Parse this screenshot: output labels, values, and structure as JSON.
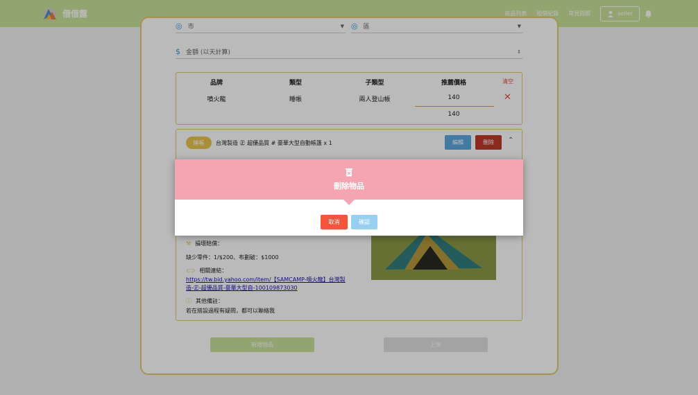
{
  "nav": {
    "brand": "借借露",
    "links": [
      "商品列表",
      "租借紀錄",
      "常見問題"
    ],
    "user": "seller"
  },
  "form": {
    "city_placeholder": "市",
    "district_placeholder": "區",
    "amount_placeholder": "金額 (以天計算)"
  },
  "table": {
    "headers": [
      "品牌",
      "類型",
      "子類型",
      "推薦價格"
    ],
    "clear_label": "清空",
    "row": [
      "噴火龍",
      "睡帳",
      "兩人登山帳",
      "140"
    ],
    "total": "140"
  },
  "item": {
    "tag": "睡帳",
    "title": "台灣製造 ㊣ 超優品質 # 豪華大型自動帳篷 x 1",
    "edit_label": "編輯",
    "delete_label": "刪除",
    "damage_label": "損壞賠償：",
    "damage_text": "缺少零件：1/$200、布劃破：$1000",
    "link_label": "相關連結：",
    "link_text": "https://tw.bid.yahoo.com/item/【SAMCAMP-噴火龍】台灣製造-㊣-超優品質-豪華大型自-100109873030",
    "notes_label": "其他備註：",
    "notes_text": "若在搭設過程有疑問，都可以聯絡我"
  },
  "actions": {
    "add_label": "新增物品",
    "upload_label": "上架"
  },
  "modal": {
    "title": "刪除物品",
    "cancel_label": "取消",
    "confirm_label": "確認"
  },
  "colors": {
    "nav": "#c9e29a",
    "accent": "#e2c96a",
    "danger": "#e74c3c",
    "modal_header": "#f5a5b1",
    "confirm": "#96cff0"
  }
}
